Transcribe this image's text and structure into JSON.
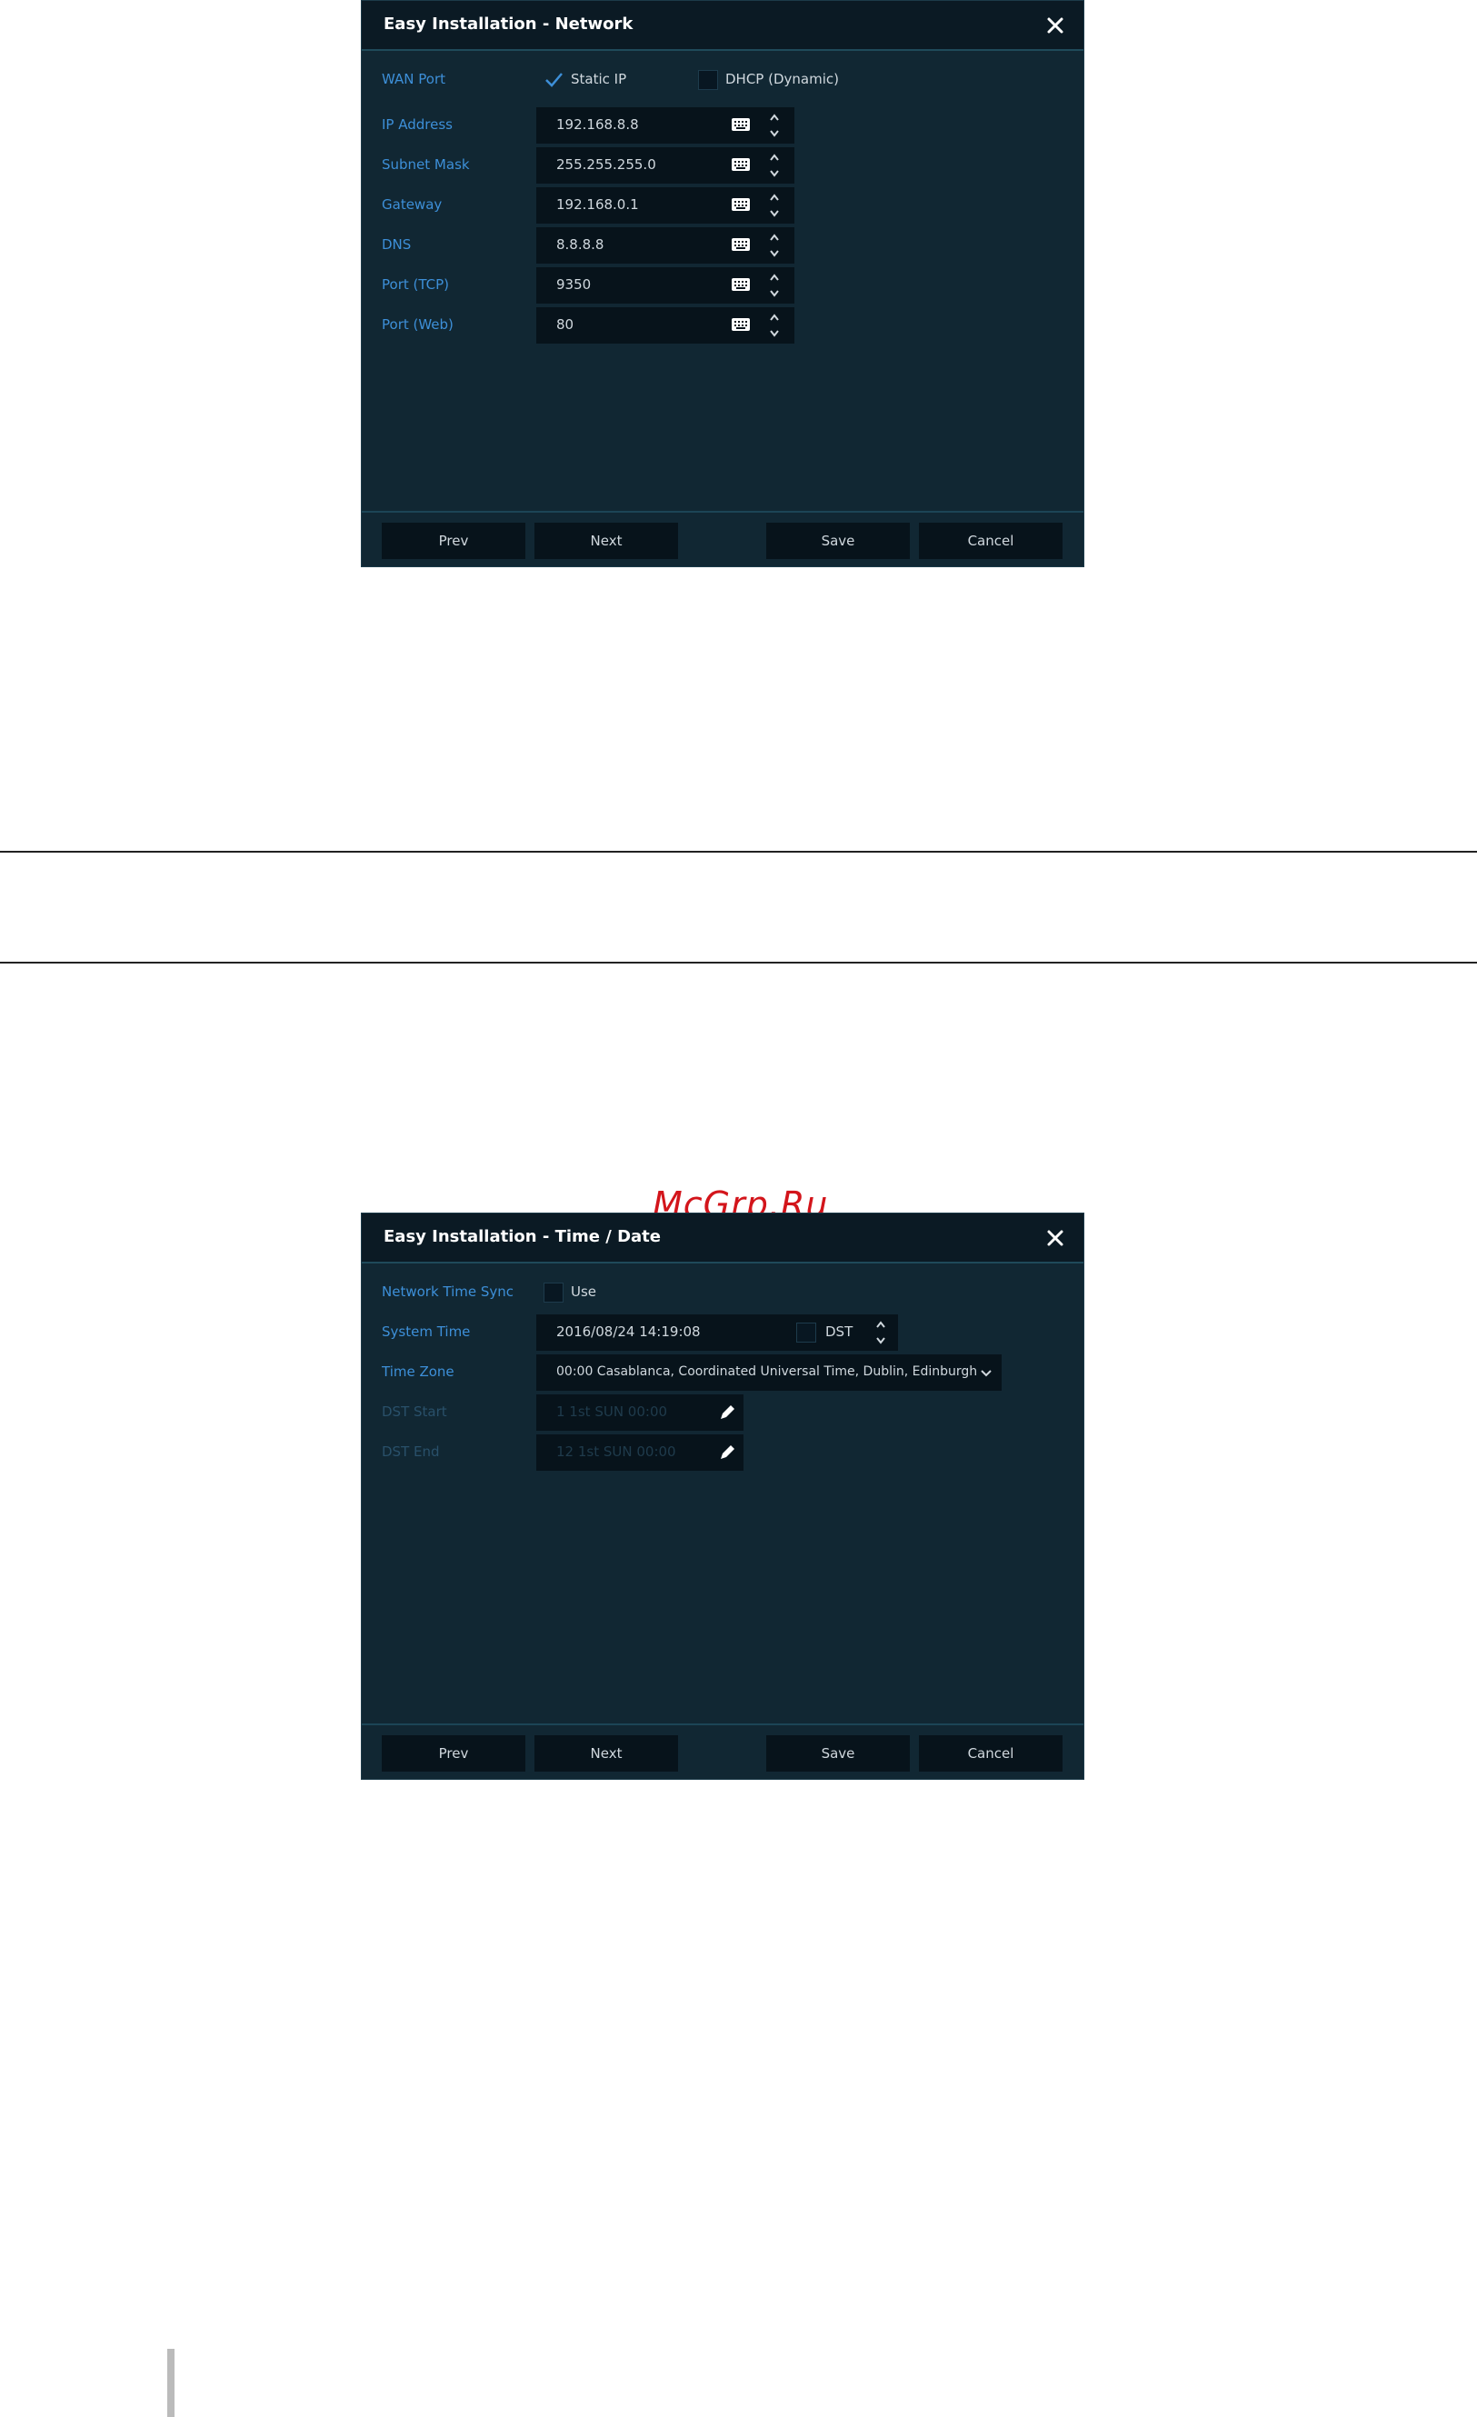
{
  "network_dialog": {
    "title": "Easy Installation - Network",
    "wan_port_label": "WAN Port",
    "static_ip_label": "Static IP",
    "static_ip_checked": true,
    "dhcp_label": "DHCP (Dynamic)",
    "dhcp_checked": false,
    "fields": [
      {
        "label": "IP Address",
        "value": "192.168.8.8"
      },
      {
        "label": "Subnet Mask",
        "value": "255.255.255.0"
      },
      {
        "label": "Gateway",
        "value": "192.168.0.1"
      },
      {
        "label": "DNS",
        "value": "8.8.8.8"
      },
      {
        "label": "Port (TCP)",
        "value": "9350"
      },
      {
        "label": "Port (Web)",
        "value": "80"
      }
    ],
    "buttons": {
      "prev": "Prev",
      "next": "Next",
      "save": "Save",
      "cancel": "Cancel"
    }
  },
  "watermark": "McGrp.Ru",
  "time_dialog": {
    "title": "Easy Installation - Time / Date",
    "network_time_sync_label": "Network Time Sync",
    "use_label": "Use",
    "use_checked": false,
    "system_time_label": "System Time",
    "system_time_value": "2016/08/24 14:19:08",
    "dst_label": "DST",
    "dst_checked": false,
    "time_zone_label": "Time Zone",
    "time_zone_value": "00:00 Casablanca, Coordinated Universal Time, Dublin, Edinburgh",
    "dst_start_label": "DST Start",
    "dst_start_value": "1 1st SUN 00:00",
    "dst_end_label": "DST End",
    "dst_end_value": "12 1st SUN 00:00",
    "buttons": {
      "prev": "Prev",
      "next": "Next",
      "save": "Save",
      "cancel": "Cancel"
    }
  },
  "colors": {
    "dialog_bg": "#112733",
    "title_bg": "#0b1a24",
    "label": "#3d8fd8",
    "field_bg": "#07131b",
    "watermark": "#d3151b"
  }
}
